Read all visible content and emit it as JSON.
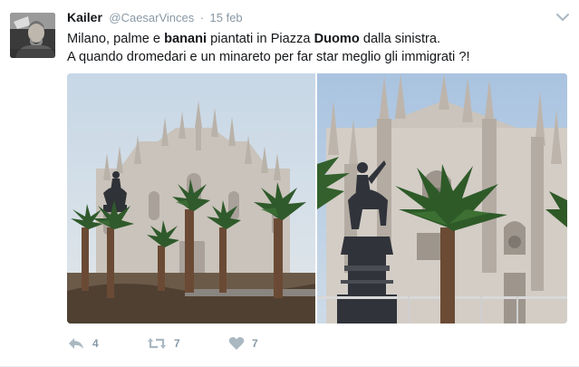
{
  "tweet": {
    "author_name": "Kailer",
    "handle": "@CaesarVinces",
    "separator": "·",
    "timestamp": "15 feb",
    "text": {
      "line1_a": "Milano, palme e ",
      "line1_b": "banani",
      "line1_c": " piantati in Piazza ",
      "line1_d": "Duomo",
      "line1_e": " dalla sinistra.",
      "line2": "A quando dromedari e un minareto per far star meglio gli immigrati ?!"
    },
    "media": [
      {
        "icon": "photo-duomo-palms-left"
      },
      {
        "icon": "photo-duomo-palms-right"
      }
    ],
    "actions": {
      "reply_count": "4",
      "retweet_count": "7",
      "like_count": "7"
    }
  },
  "colors": {
    "text": "#14171a",
    "secondary": "#8899a6",
    "action_icon": "#aab8c2",
    "divider": "#e6ecf0"
  }
}
